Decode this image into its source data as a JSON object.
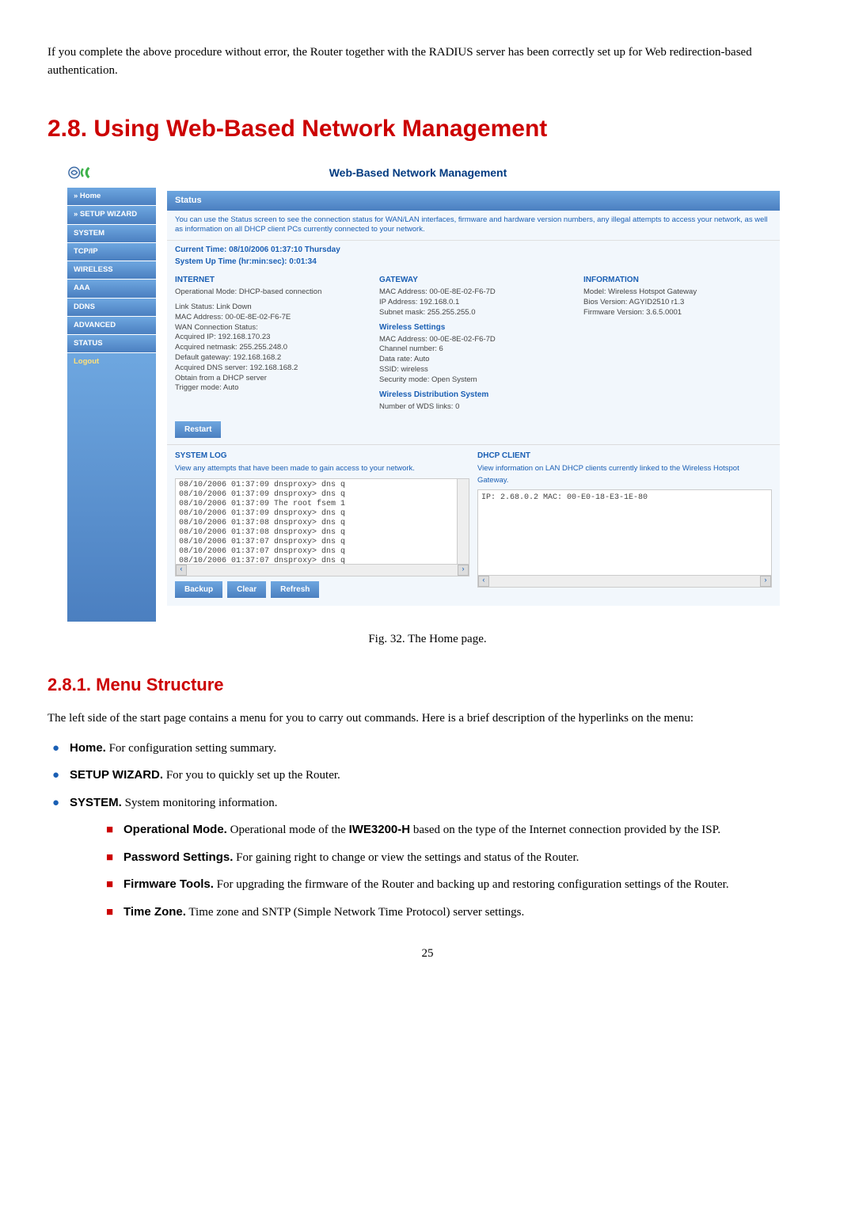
{
  "intro": "If you complete the above procedure without error, the Router together with the RADIUS server has been correctly set up for Web redirection-based authentication.",
  "section_2_8": "2.8. Using Web-Based Network Management",
  "mgmt_title": "Web-Based Network Management",
  "side": {
    "items": [
      "» Home",
      "» SETUP WIZARD",
      "SYSTEM",
      "TCP/IP",
      "WIRELESS",
      "AAA",
      "DDNS",
      "ADVANCED",
      "STATUS"
    ],
    "logout": "Logout"
  },
  "status_hd": "Status",
  "desc": "You can use the Status screen to see the connection status for WAN/LAN interfaces, firmware and hardware version numbers, any illegal attempts to access your network, as well as information on all DHCP client PCs currently connected to your network.",
  "time1": "Current Time: 08/10/2006 01:37:10 Thursday",
  "time2": "System Up Time (hr:min:sec): 0:01:34",
  "col1": {
    "h_internet": "INTERNET",
    "op_mode": "Operational Mode: DHCP-based connection",
    "link": "Link Status: Link Down",
    "mac": "MAC Address: 00-0E-8E-02-F6-7E",
    "wan": "WAN Connection Status:",
    "ip": "Acquired IP: 192.168.170.23",
    "nm": "Acquired netmask: 255.255.248.0",
    "gw": "Default gateway: 192.168.168.2",
    "dns": "Acquired DNS server: 192.168.168.2",
    "obt": "Obtain from a DHCP server",
    "trig": "Trigger mode: Auto"
  },
  "col2": {
    "h_gateway": "GATEWAY",
    "mac": "MAC Address: 00-0E-8E-02-F6-7D",
    "ip": "IP Address: 192.168.0.1",
    "sub": "Subnet mask: 255.255.255.0",
    "h_ws": "Wireless Settings",
    "wmac": "MAC Address: 00-0E-8E-02-F6-7D",
    "ch": "Channel number: 6",
    "rate": "Data rate: Auto",
    "ssid": "SSID: wireless",
    "sec": "Security mode: Open System",
    "h_wds": "Wireless Distribution System",
    "wds": "Number of WDS links: 0"
  },
  "col3": {
    "h_info": "INFORMATION",
    "model": "Model: Wireless Hotspot Gateway",
    "bios": "Bios Version: AGYID2510 r1.3",
    "fw": "Firmware Version: 3.6.5.0001"
  },
  "restart": "Restart",
  "log": {
    "hd": "SYSTEM LOG",
    "sub": "View any attempts that have been made to gain access to your network.",
    "lines": "08/10/2006 01:37:09 dnsproxy> dns q\n08/10/2006 01:37:09 dnsproxy> dns q\n08/10/2006 01:37:09 The root fsem 1\n08/10/2006 01:37:09 dnsproxy> dns q\n08/10/2006 01:37:08 dnsproxy> dns q\n08/10/2006 01:37:08 dnsproxy> dns q\n08/10/2006 01:37:07 dnsproxy> dns q\n08/10/2006 01:37:07 dnsproxy> dns q\n08/10/2006 01:37:07 dnsproxy> dns q"
  },
  "btns": {
    "backup": "Backup",
    "clear": "Clear",
    "refresh": "Refresh"
  },
  "dhcp": {
    "hd": "DHCP CLIENT",
    "sub": "View information on LAN DHCP clients currently linked to the Wireless Hotspot Gateway.",
    "line": "IP: 2.68.0.2 MAC: 00-E0-18-E3-1E-80"
  },
  "caption": "Fig. 32. The Home page.",
  "section_2_8_1": "2.8.1. Menu Structure",
  "para_menu": "The left side of the start page contains a menu for you to carry out commands. Here is a brief description of the hyperlinks on the menu:",
  "b_home_label": "Home.",
  "b_home_txt": "   For configuration setting summary.",
  "b_setup_label": "SETUP WIZARD.",
  "b_setup_txt": " For you to quickly set up the Router.",
  "b_system_label": "SYSTEM.",
  "b_system_txt": " System monitoring information.",
  "s_op_label": "Operational Mode.",
  "s_op_txt": " Operational mode of the ",
  "s_op_bold": "IWE3200-H",
  "s_op_txt2": " based on the type of the Internet connection provided by the ISP.",
  "s_pw_label": "Password Settings.",
  "s_pw_txt": " For gaining right to change or view the settings and status of the Router.",
  "s_fw_label": "Firmware Tools.",
  "s_fw_txt": " For upgrading the firmware of the Router and backing up and restoring configuration settings of the Router.",
  "s_tz_label": "Time Zone.",
  "s_tz_txt": " Time zone and SNTP (Simple Network Time Protocol) server settings.",
  "page_num": "25"
}
